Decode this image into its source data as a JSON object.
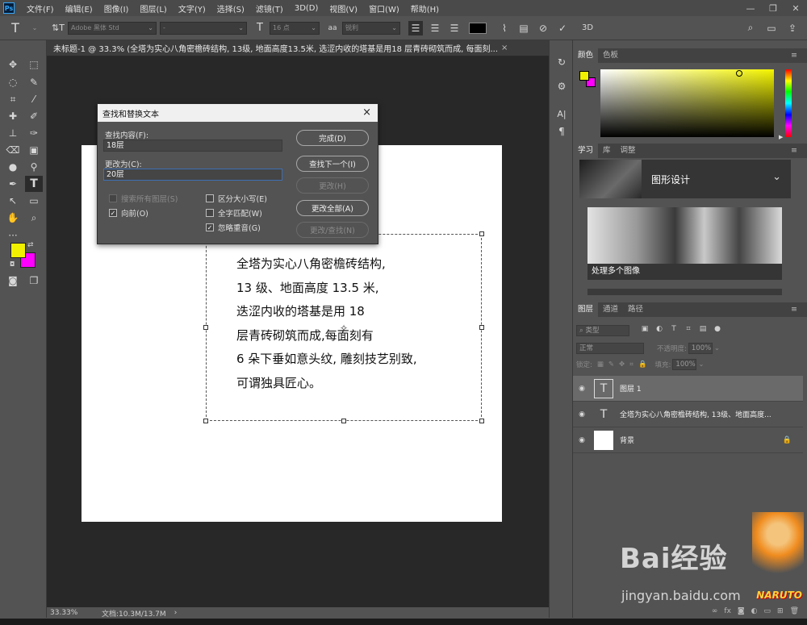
{
  "menubar": {
    "logo": "Ps",
    "items": [
      "文件(F)",
      "编辑(E)",
      "图像(I)",
      "图层(L)",
      "文字(Y)",
      "选择(S)",
      "滤镜(T)",
      "3D(D)",
      "视图(V)",
      "窗口(W)",
      "帮助(H)"
    ],
    "window_buttons": [
      "—",
      "❐",
      "✕"
    ]
  },
  "options": {
    "font_family": "Adobe 黑体 Std",
    "font_style": "-",
    "font_size": "16 点",
    "aa_label": "aa",
    "antialias": "锐利"
  },
  "document": {
    "tab_title": "未标题-1 @ 33.3% (全塔为实心八角密檐砖结构, 13级, 地面高度13.5米, 选涩内收的塔基是用18 层青砖砌筑而成, 每面刻...",
    "text_lines": [
      "全塔为实心八角密檐砖结构,",
      "13 级、地面高度 13.5 米,",
      "迭涩内收的塔基是用 18",
      "层青砖砌筑而成,每面刻有",
      "6 朵下垂如意头纹, 雕刻技艺别致,",
      "可谓独具匠心。"
    ]
  },
  "status": {
    "zoom": "33.33%",
    "doc_size": "文档:10.3M/13.7M"
  },
  "dialog": {
    "title": "查找和替换文本",
    "find_label": "查找内容(F):",
    "find_value": "18层",
    "change_label": "更改为(C):",
    "change_value": "20层",
    "buttons": {
      "done": "完成(D)",
      "find_next": "查找下一个(I)",
      "change": "更改(H)",
      "change_all": "更改全部(A)",
      "change_find": "更改/查找(N)"
    },
    "checkboxes": {
      "search_all_layers": {
        "label": "搜索所有图层(S)",
        "checked": false
      },
      "forward": {
        "label": "向前(O)",
        "checked": true
      },
      "case_sensitive": {
        "label": "区分大小写(E)",
        "checked": false
      },
      "whole_word": {
        "label": "全字匹配(W)",
        "checked": false
      },
      "ignore_accents": {
        "label": "忽略重音(G)",
        "checked": true
      }
    }
  },
  "color_panel": {
    "tabs": [
      "颜色",
      "色板"
    ],
    "foreground": "#f0f000",
    "background": "#ff00ff"
  },
  "learn_panel": {
    "tabs": [
      "学习",
      "库",
      "调整"
    ],
    "title": "图形设计",
    "card_label": "处理多个图像"
  },
  "layers_panel": {
    "tabs": [
      "图层",
      "通道",
      "路径"
    ],
    "filter_type": "类型",
    "blend_mode": "正常",
    "opacity_label": "不透明度:",
    "opacity": "100%",
    "lock_label": "锁定:",
    "fill_label": "填充:",
    "fill": "100%",
    "layers": [
      {
        "name": "图层 1",
        "kind": "text",
        "selected": true
      },
      {
        "name": "全塔为实心八角密檐砖结构, 13级、地面高度...",
        "kind": "text",
        "selected": false
      },
      {
        "name": "背景",
        "kind": "background",
        "selected": false
      }
    ]
  },
  "watermark": {
    "brand": "Bai经验",
    "url": "jingyan.baidu.com",
    "naruto": "NARUTO"
  }
}
